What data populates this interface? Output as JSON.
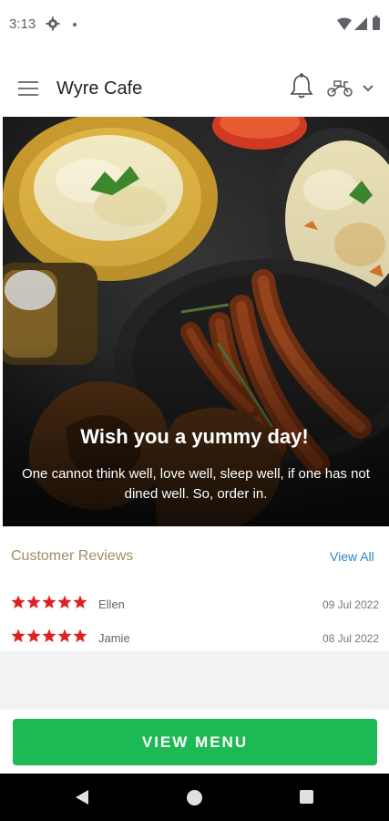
{
  "status_bar": {
    "time": "3:13"
  },
  "app_bar": {
    "title": "Wyre Cafe"
  },
  "hero": {
    "title": "Wish you a yummy day!",
    "subtitle": "One cannot think well, love well, sleep well, if one has not dined well. So, order in."
  },
  "reviews": {
    "title": "Customer Reviews",
    "view_all": "View All",
    "items": [
      {
        "name": "Ellen",
        "date": "09 Jul 2022",
        "rating": 5
      },
      {
        "name": "Jamie",
        "date": "08 Jul 2022",
        "rating": 5
      }
    ]
  },
  "cta": {
    "label": "VIEW MENU"
  },
  "colors": {
    "accent_green": "#1cb954",
    "star_red": "#e02020",
    "link_blue": "#2a86c7",
    "reviews_title": "#9c8f66"
  },
  "icons": [
    "settings-icon",
    "wifi-icon",
    "signal-icon",
    "battery-icon",
    "menu-icon",
    "bell-icon",
    "scooter-icon",
    "chevron-down-icon",
    "star-icon",
    "back-icon",
    "home-icon",
    "recents-icon"
  ]
}
